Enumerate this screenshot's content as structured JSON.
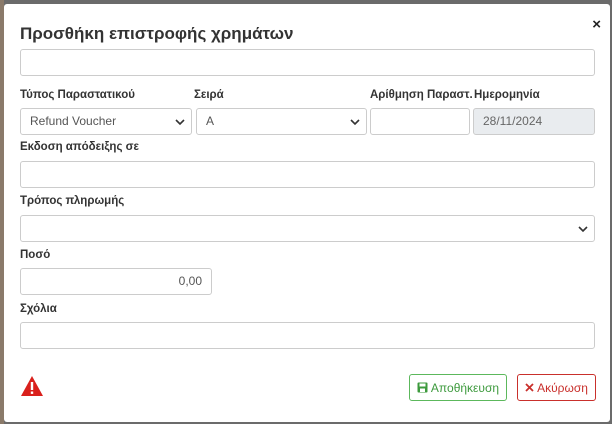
{
  "dialog": {
    "title": "Προσθήκη επιστροφής χρημάτων",
    "close_label": "×"
  },
  "fields": {
    "top_input": {
      "value": ""
    },
    "doc_type": {
      "label": "Τύπος Παραστατικού",
      "value": "Refund Voucher"
    },
    "series": {
      "label": "Σειρά",
      "value": "A"
    },
    "doc_number": {
      "label": "Αρίθμηση Παραστ.",
      "value": ""
    },
    "date": {
      "label": "Ημερομηνία",
      "value": "28/11/2024"
    },
    "receipt_issued_to": {
      "label": "Εκδοση απόδειξης σε",
      "value": ""
    },
    "payment_method": {
      "label": "Τρόπος πληρωμής",
      "value": ""
    },
    "amount": {
      "label": "Ποσό",
      "value": "0,00"
    },
    "comments": {
      "label": "Σχόλια",
      "value": ""
    }
  },
  "buttons": {
    "save_label": "Αποθήκευση",
    "cancel_label": "Ακύρωση"
  },
  "icons": {
    "warning": "warning-triangle-icon",
    "save": "floppy-disk-icon",
    "cancel": "x-icon",
    "dropdown": "chevron-down-icon"
  },
  "colors": {
    "save_accent": "#5cb85c",
    "cancel_accent": "#c9302c",
    "warning": "#d9201c"
  }
}
